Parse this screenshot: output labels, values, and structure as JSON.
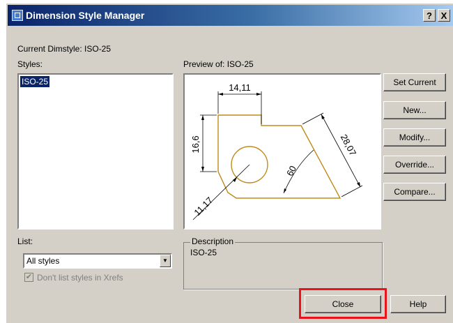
{
  "window": {
    "title": "Dimension Style Manager",
    "help_btn": "?",
    "close_btn": "X"
  },
  "current_dimstyle": "Current Dimstyle: ISO-25",
  "styles": {
    "label": "Styles:",
    "items": [
      "ISO-25"
    ],
    "selected": "ISO-25"
  },
  "preview": {
    "label": "Preview of: ISO-25",
    "dimensions": [
      "14,11",
      "16,6",
      "28,07",
      "60",
      "11,17"
    ]
  },
  "buttons": {
    "set_current": "Set Current",
    "new": "New...",
    "modify": "Modify...",
    "override": "Override...",
    "compare": "Compare...",
    "close": "Close",
    "help": "Help"
  },
  "list": {
    "label": "List:",
    "value": "All styles",
    "dont_list_xrefs": "Don't list styles in Xrefs",
    "dont_list_xrefs_checked": true
  },
  "description": {
    "label": "Description",
    "text": "ISO-25"
  },
  "colors": {
    "titlebar_start": "#0a246a",
    "titlebar_end": "#a6caf0",
    "dialog_bg": "#d4d0c8",
    "selection": "#0a246a",
    "geometry": "#c08a1a",
    "highlight": "#e8141c"
  }
}
